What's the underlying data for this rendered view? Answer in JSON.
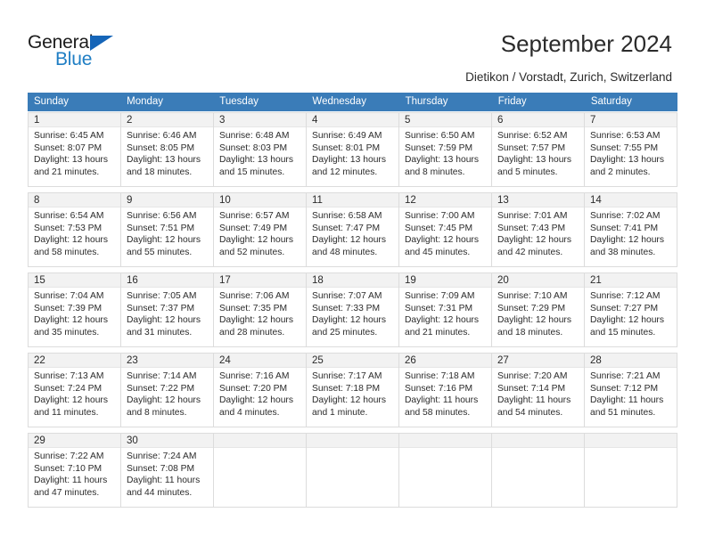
{
  "brand": {
    "name_part1": "General",
    "name_part2": "Blue",
    "triangle_color": "#1565b8",
    "blue_color": "#1f7ec4"
  },
  "header": {
    "title": "September 2024",
    "subtitle": "Dietikon / Vorstadt, Zurich, Switzerland",
    "header_bg": "#3a7cb8"
  },
  "weekdays": [
    "Sunday",
    "Monday",
    "Tuesday",
    "Wednesday",
    "Thursday",
    "Friday",
    "Saturday"
  ],
  "weeks": [
    [
      {
        "day": "1",
        "sunrise": "Sunrise: 6:45 AM",
        "sunset": "Sunset: 8:07 PM",
        "daylight1": "Daylight: 13 hours",
        "daylight2": "and 21 minutes."
      },
      {
        "day": "2",
        "sunrise": "Sunrise: 6:46 AM",
        "sunset": "Sunset: 8:05 PM",
        "daylight1": "Daylight: 13 hours",
        "daylight2": "and 18 minutes."
      },
      {
        "day": "3",
        "sunrise": "Sunrise: 6:48 AM",
        "sunset": "Sunset: 8:03 PM",
        "daylight1": "Daylight: 13 hours",
        "daylight2": "and 15 minutes."
      },
      {
        "day": "4",
        "sunrise": "Sunrise: 6:49 AM",
        "sunset": "Sunset: 8:01 PM",
        "daylight1": "Daylight: 13 hours",
        "daylight2": "and 12 minutes."
      },
      {
        "day": "5",
        "sunrise": "Sunrise: 6:50 AM",
        "sunset": "Sunset: 7:59 PM",
        "daylight1": "Daylight: 13 hours",
        "daylight2": "and 8 minutes."
      },
      {
        "day": "6",
        "sunrise": "Sunrise: 6:52 AM",
        "sunset": "Sunset: 7:57 PM",
        "daylight1": "Daylight: 13 hours",
        "daylight2": "and 5 minutes."
      },
      {
        "day": "7",
        "sunrise": "Sunrise: 6:53 AM",
        "sunset": "Sunset: 7:55 PM",
        "daylight1": "Daylight: 13 hours",
        "daylight2": "and 2 minutes."
      }
    ],
    [
      {
        "day": "8",
        "sunrise": "Sunrise: 6:54 AM",
        "sunset": "Sunset: 7:53 PM",
        "daylight1": "Daylight: 12 hours",
        "daylight2": "and 58 minutes."
      },
      {
        "day": "9",
        "sunrise": "Sunrise: 6:56 AM",
        "sunset": "Sunset: 7:51 PM",
        "daylight1": "Daylight: 12 hours",
        "daylight2": "and 55 minutes."
      },
      {
        "day": "10",
        "sunrise": "Sunrise: 6:57 AM",
        "sunset": "Sunset: 7:49 PM",
        "daylight1": "Daylight: 12 hours",
        "daylight2": "and 52 minutes."
      },
      {
        "day": "11",
        "sunrise": "Sunrise: 6:58 AM",
        "sunset": "Sunset: 7:47 PM",
        "daylight1": "Daylight: 12 hours",
        "daylight2": "and 48 minutes."
      },
      {
        "day": "12",
        "sunrise": "Sunrise: 7:00 AM",
        "sunset": "Sunset: 7:45 PM",
        "daylight1": "Daylight: 12 hours",
        "daylight2": "and 45 minutes."
      },
      {
        "day": "13",
        "sunrise": "Sunrise: 7:01 AM",
        "sunset": "Sunset: 7:43 PM",
        "daylight1": "Daylight: 12 hours",
        "daylight2": "and 42 minutes."
      },
      {
        "day": "14",
        "sunrise": "Sunrise: 7:02 AM",
        "sunset": "Sunset: 7:41 PM",
        "daylight1": "Daylight: 12 hours",
        "daylight2": "and 38 minutes."
      }
    ],
    [
      {
        "day": "15",
        "sunrise": "Sunrise: 7:04 AM",
        "sunset": "Sunset: 7:39 PM",
        "daylight1": "Daylight: 12 hours",
        "daylight2": "and 35 minutes."
      },
      {
        "day": "16",
        "sunrise": "Sunrise: 7:05 AM",
        "sunset": "Sunset: 7:37 PM",
        "daylight1": "Daylight: 12 hours",
        "daylight2": "and 31 minutes."
      },
      {
        "day": "17",
        "sunrise": "Sunrise: 7:06 AM",
        "sunset": "Sunset: 7:35 PM",
        "daylight1": "Daylight: 12 hours",
        "daylight2": "and 28 minutes."
      },
      {
        "day": "18",
        "sunrise": "Sunrise: 7:07 AM",
        "sunset": "Sunset: 7:33 PM",
        "daylight1": "Daylight: 12 hours",
        "daylight2": "and 25 minutes."
      },
      {
        "day": "19",
        "sunrise": "Sunrise: 7:09 AM",
        "sunset": "Sunset: 7:31 PM",
        "daylight1": "Daylight: 12 hours",
        "daylight2": "and 21 minutes."
      },
      {
        "day": "20",
        "sunrise": "Sunrise: 7:10 AM",
        "sunset": "Sunset: 7:29 PM",
        "daylight1": "Daylight: 12 hours",
        "daylight2": "and 18 minutes."
      },
      {
        "day": "21",
        "sunrise": "Sunrise: 7:12 AM",
        "sunset": "Sunset: 7:27 PM",
        "daylight1": "Daylight: 12 hours",
        "daylight2": "and 15 minutes."
      }
    ],
    [
      {
        "day": "22",
        "sunrise": "Sunrise: 7:13 AM",
        "sunset": "Sunset: 7:24 PM",
        "daylight1": "Daylight: 12 hours",
        "daylight2": "and 11 minutes."
      },
      {
        "day": "23",
        "sunrise": "Sunrise: 7:14 AM",
        "sunset": "Sunset: 7:22 PM",
        "daylight1": "Daylight: 12 hours",
        "daylight2": "and 8 minutes."
      },
      {
        "day": "24",
        "sunrise": "Sunrise: 7:16 AM",
        "sunset": "Sunset: 7:20 PM",
        "daylight1": "Daylight: 12 hours",
        "daylight2": "and 4 minutes."
      },
      {
        "day": "25",
        "sunrise": "Sunrise: 7:17 AM",
        "sunset": "Sunset: 7:18 PM",
        "daylight1": "Daylight: 12 hours",
        "daylight2": "and 1 minute."
      },
      {
        "day": "26",
        "sunrise": "Sunrise: 7:18 AM",
        "sunset": "Sunset: 7:16 PM",
        "daylight1": "Daylight: 11 hours",
        "daylight2": "and 58 minutes."
      },
      {
        "day": "27",
        "sunrise": "Sunrise: 7:20 AM",
        "sunset": "Sunset: 7:14 PM",
        "daylight1": "Daylight: 11 hours",
        "daylight2": "and 54 minutes."
      },
      {
        "day": "28",
        "sunrise": "Sunrise: 7:21 AM",
        "sunset": "Sunset: 7:12 PM",
        "daylight1": "Daylight: 11 hours",
        "daylight2": "and 51 minutes."
      }
    ],
    [
      {
        "day": "29",
        "sunrise": "Sunrise: 7:22 AM",
        "sunset": "Sunset: 7:10 PM",
        "daylight1": "Daylight: 11 hours",
        "daylight2": "and 47 minutes."
      },
      {
        "day": "30",
        "sunrise": "Sunrise: 7:24 AM",
        "sunset": "Sunset: 7:08 PM",
        "daylight1": "Daylight: 11 hours",
        "daylight2": "and 44 minutes."
      },
      {
        "day": "",
        "sunrise": "",
        "sunset": "",
        "daylight1": "",
        "daylight2": ""
      },
      {
        "day": "",
        "sunrise": "",
        "sunset": "",
        "daylight1": "",
        "daylight2": ""
      },
      {
        "day": "",
        "sunrise": "",
        "sunset": "",
        "daylight1": "",
        "daylight2": ""
      },
      {
        "day": "",
        "sunrise": "",
        "sunset": "",
        "daylight1": "",
        "daylight2": ""
      },
      {
        "day": "",
        "sunrise": "",
        "sunset": "",
        "daylight1": "",
        "daylight2": ""
      }
    ]
  ]
}
